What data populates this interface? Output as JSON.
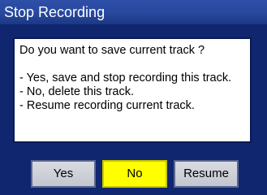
{
  "title_bar": {
    "title": "Stop Recording"
  },
  "dialog": {
    "question": "Do you want to save current track ?",
    "options": [
      "- Yes, save and stop recording this track.",
      "- No, delete this track.",
      "- Resume recording current track."
    ]
  },
  "buttons": {
    "yes_label": "Yes",
    "no_label": "No",
    "resume_label": "Resume",
    "selected": "No"
  },
  "colors": {
    "background": "#10266e",
    "title_bar": "#27489e",
    "selected_button": "#ffff00",
    "button": "#c9ccd4"
  }
}
